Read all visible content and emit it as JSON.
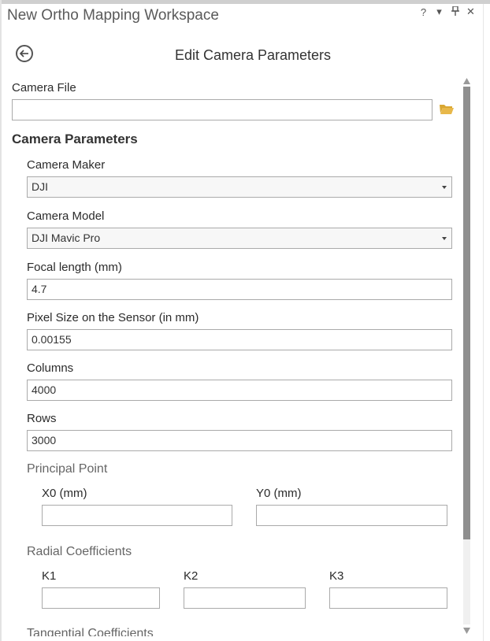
{
  "pane": {
    "title": "New Ortho Mapping Workspace",
    "controls": {
      "help": "?",
      "menu": "▾",
      "pin": "⬆",
      "close": "✕"
    }
  },
  "header": {
    "back_icon": "arrow-left-circle-icon",
    "title": "Edit Camera Parameters"
  },
  "camera_file": {
    "label": "Camera File",
    "value": "",
    "browse_icon": "folder-open-icon"
  },
  "section_title": "Camera Parameters",
  "camera_maker": {
    "label": "Camera Maker",
    "value": "DJI"
  },
  "camera_model": {
    "label": "Camera Model",
    "value": "DJI Mavic Pro"
  },
  "focal_length": {
    "label": "Focal length (mm)",
    "value": "4.7"
  },
  "pixel_size": {
    "label": "Pixel Size on the Sensor (in mm)",
    "value": "0.00155"
  },
  "columns": {
    "label": "Columns",
    "value": "4000"
  },
  "rows": {
    "label": "Rows",
    "value": "3000"
  },
  "principal_point": {
    "title": "Principal Point",
    "x0": {
      "label": "X0 (mm)",
      "value": ""
    },
    "y0": {
      "label": "Y0 (mm)",
      "value": ""
    }
  },
  "radial_coefficients": {
    "title": "Radial Coefficients",
    "k1": {
      "label": "K1",
      "value": ""
    },
    "k2": {
      "label": "K2",
      "value": ""
    },
    "k3": {
      "label": "K3",
      "value": ""
    }
  },
  "tangential_coefficients": {
    "title": "Tangential Coefficients"
  },
  "colors": {
    "accent_folder": "#e8b84a",
    "scroll_thumb": "#8f8f8f",
    "field_border": "#aaaaaa"
  }
}
